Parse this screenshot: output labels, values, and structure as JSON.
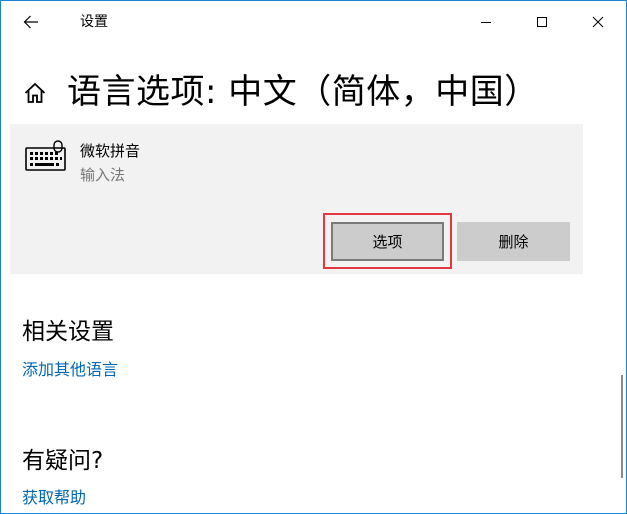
{
  "window": {
    "title": "设置",
    "accent_color": "#1883d7"
  },
  "icons": {
    "back": "back-arrow-icon",
    "minimize": "minimize-icon",
    "maximize": "maximize-icon",
    "close": "close-icon",
    "home": "home-icon",
    "keyboard": "keyboard-icon"
  },
  "page": {
    "title": "语言选项: 中文（简体，中国）"
  },
  "ime": {
    "name": "微软拼音",
    "type": "输入法",
    "options_label": "选项",
    "delete_label": "删除",
    "highlight_color": "#e0383e"
  },
  "related": {
    "title": "相关设置",
    "link": "添加其他语言"
  },
  "help": {
    "title": "有疑问?",
    "link": "获取帮助",
    "link_color": "#0066b4"
  }
}
